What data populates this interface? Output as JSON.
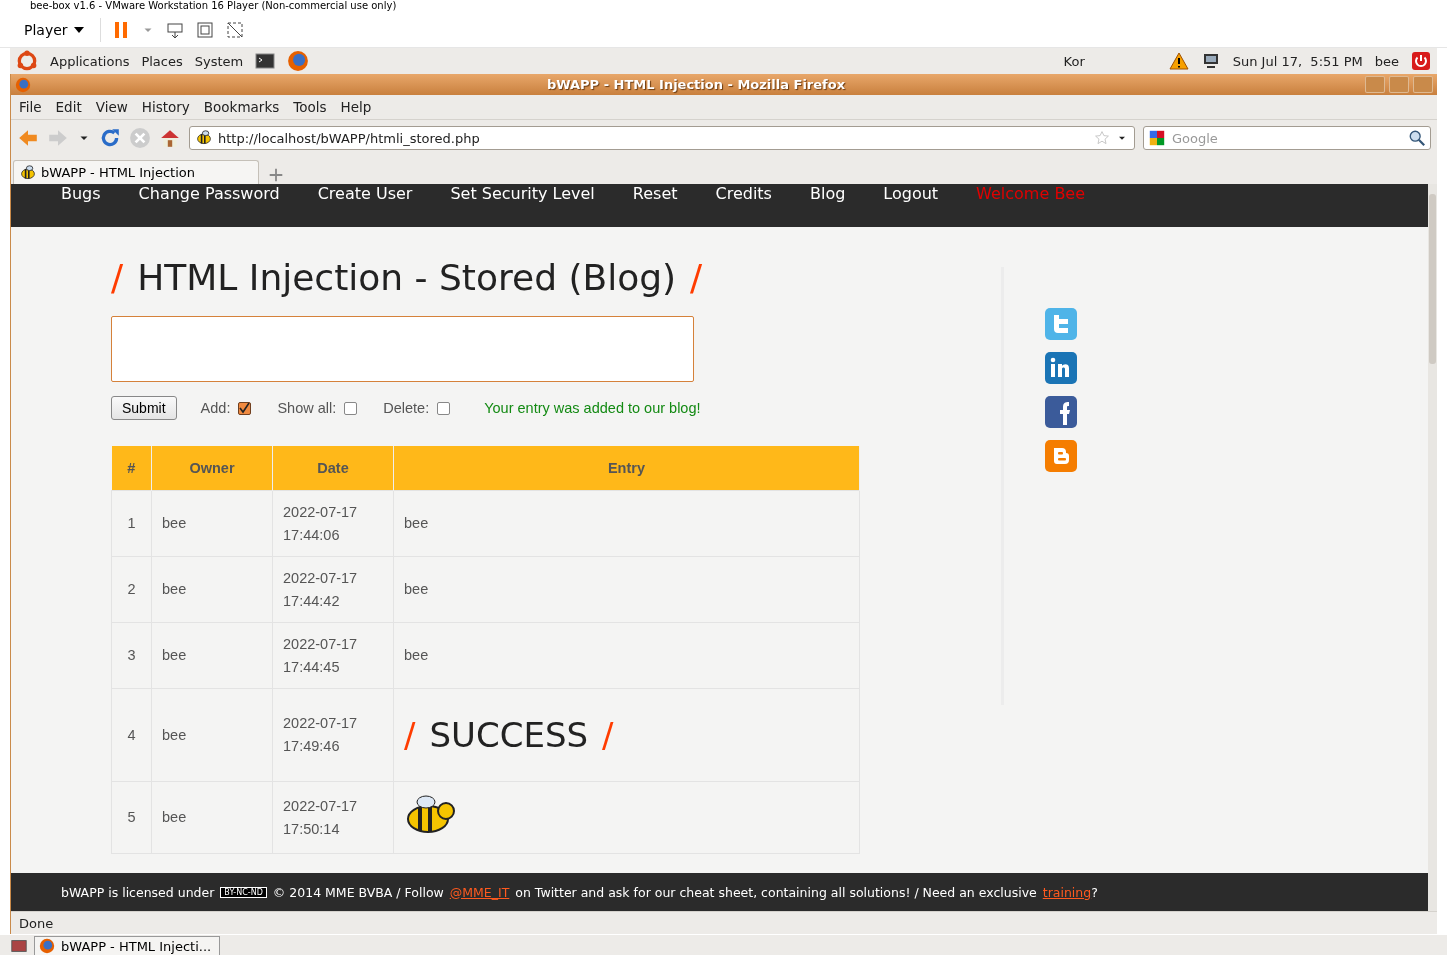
{
  "vmware": {
    "title": "bee-box v1.6 - VMware Workstation 16 Player (Non-commercial use only)",
    "player_menu": "Player"
  },
  "panel": {
    "menus": [
      "Applications",
      "Places",
      "System"
    ],
    "keyboard": "Kor",
    "clock": "Sun Jul 17,  5:51 PM",
    "user": "bee"
  },
  "firefox": {
    "title": "bWAPP - HTML Injection - Mozilla Firefox",
    "menu": [
      "File",
      "Edit",
      "View",
      "History",
      "Bookmarks",
      "Tools",
      "Help"
    ],
    "url": "http://localhost/bWAPP/htmli_stored.php",
    "search_placeholder": "Google",
    "tabs": [
      {
        "label": "bWAPP - HTML Injection",
        "selected": true
      }
    ],
    "status": "Done"
  },
  "page": {
    "nav": [
      {
        "label": "Bugs",
        "kind": "link"
      },
      {
        "label": "Change Password",
        "kind": "link"
      },
      {
        "label": "Create User",
        "kind": "link"
      },
      {
        "label": "Set Security Level",
        "kind": "link"
      },
      {
        "label": "Reset",
        "kind": "link"
      },
      {
        "label": "Credits",
        "kind": "link"
      },
      {
        "label": "Blog",
        "kind": "link"
      },
      {
        "label": "Logout",
        "kind": "link"
      },
      {
        "label": "Welcome Bee",
        "kind": "welcome"
      }
    ],
    "heading": "HTML Injection - Stored (Blog)",
    "slash": "/",
    "submit": "Submit",
    "options": [
      {
        "label": "Add:",
        "checked": true
      },
      {
        "label": "Show all:",
        "checked": false
      },
      {
        "label": "Delete:",
        "checked": false
      }
    ],
    "message": "Your entry was added to our blog!",
    "table": {
      "columns": [
        "#",
        "Owner",
        "Date",
        "Entry"
      ],
      "rows": [
        {
          "num": "1",
          "owner": "bee",
          "date": "2022-07-17",
          "time": "17:44:06",
          "kind": "text",
          "entry": "bee"
        },
        {
          "num": "2",
          "owner": "bee",
          "date": "2022-07-17",
          "time": "17:44:42",
          "kind": "text",
          "entry": "bee"
        },
        {
          "num": "3",
          "owner": "bee",
          "date": "2022-07-17",
          "time": "17:44:45",
          "kind": "text",
          "entry": "bee"
        },
        {
          "num": "4",
          "owner": "bee",
          "date": "2022-07-17",
          "time": "17:49:46",
          "kind": "heading",
          "entry": "SUCCESS"
        },
        {
          "num": "5",
          "owner": "bee",
          "date": "2022-07-17",
          "time": "17:50:14",
          "kind": "image"
        }
      ]
    },
    "footer": {
      "before": "bWAPP is licensed under",
      "badge": "BY-NC-ND",
      "middle": "© 2014 MME BVBA / Follow",
      "twitter": "@MME_IT",
      "after": "on Twitter and ask for our cheat sheet, containing all solutions! / Need an exclusive",
      "link": "training",
      "end": "?"
    }
  },
  "taskbar": {
    "window": "bWAPP - HTML Injecti..."
  }
}
